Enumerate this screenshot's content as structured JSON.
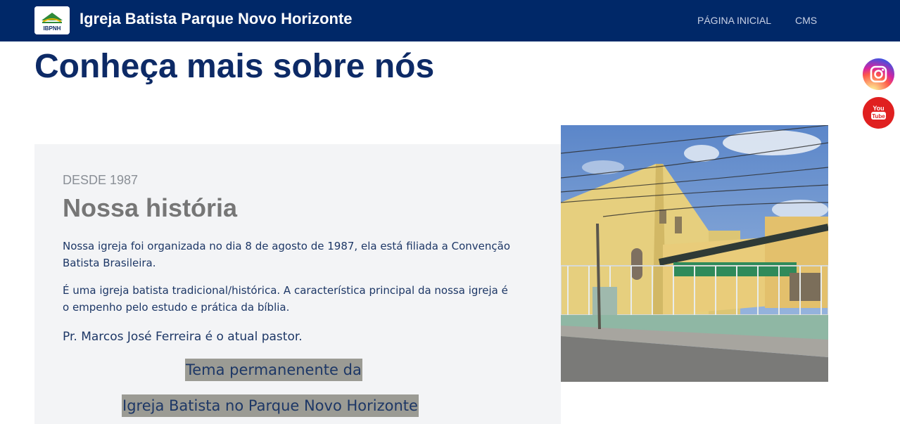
{
  "header": {
    "brand_name": "Igreja Batista Parque Novo Horizonte",
    "logo_text": "IBPNH",
    "nav": [
      {
        "label": "PÁGINA INICIAL"
      },
      {
        "label": "CMS"
      }
    ]
  },
  "main": {
    "page_title": "Conheça mais sobre nós"
  },
  "social": {
    "instagram_icon": "instagram-icon",
    "youtube_label_1": "You",
    "youtube_label_2": "Tube"
  },
  "history": {
    "eyebrow": "DESDE 1987",
    "title": "Nossa história",
    "paragraphs": [
      "Nossa igreja foi organizada no dia 8 de agosto de 1987, ela está filiada a Convenção Batista Brasileira.",
      "É uma igreja batista tradicional/histórica. A característica principal da nossa igreja é o empenho pelo estudo e prática da bíblia.",
      "Pr. Marcos José Ferreira é o atual pastor."
    ],
    "theme_lines": [
      "Tema  permanenente da",
      "Igreja Batista no Parque Novo Horizonte"
    ]
  },
  "colors": {
    "navbar": "#002868",
    "title": "#0d2a66",
    "card_background": "#f3f4f6",
    "theme_highlight": "#9b9b94"
  }
}
